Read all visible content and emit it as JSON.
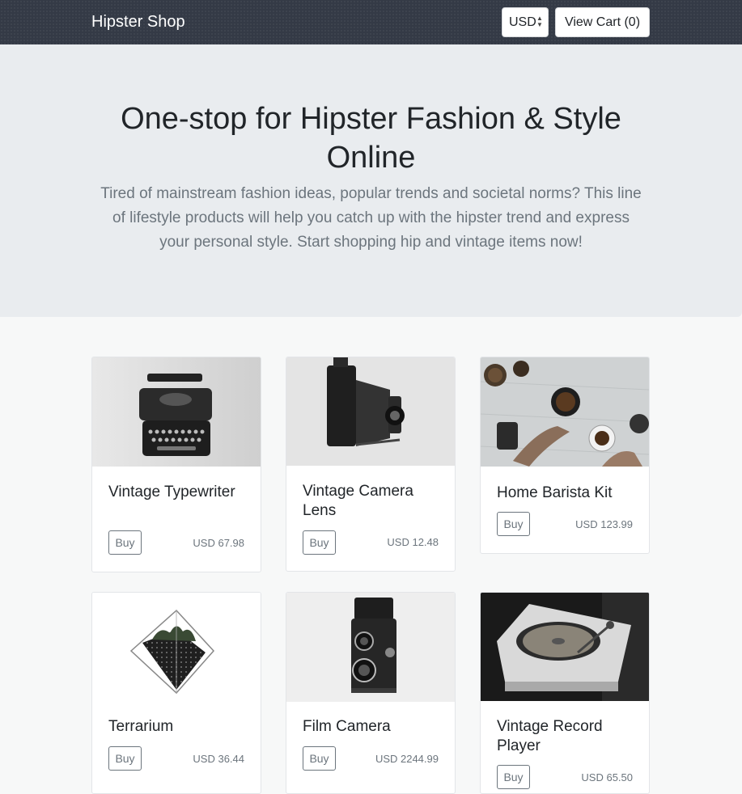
{
  "navbar": {
    "brand": "Hipster Shop",
    "currency": "USD",
    "cart_label": "View Cart (0)"
  },
  "hero": {
    "title": "One-stop for Hipster Fashion & Style Online",
    "subtitle": "Tired of mainstream fashion ideas, popular trends and societal norms? This line of lifestyle products will help you catch up with the hipster trend and express your personal style. Start shopping hip and vintage items now!"
  },
  "products": [
    {
      "name": "Vintage Typewriter",
      "buy_label": "Buy",
      "price": "USD 67.98",
      "icon": "typewriter-image"
    },
    {
      "name": "Vintage Camera Lens",
      "buy_label": "Buy",
      "price": "USD 12.48",
      "icon": "camera-lens-image"
    },
    {
      "name": "Home Barista Kit",
      "buy_label": "Buy",
      "price": "USD 123.99",
      "icon": "barista-kit-image"
    },
    {
      "name": "Terrarium",
      "buy_label": "Buy",
      "price": "USD 36.44",
      "icon": "terrarium-image"
    },
    {
      "name": "Film Camera",
      "buy_label": "Buy",
      "price": "USD 2244.99",
      "icon": "film-camera-image"
    },
    {
      "name": "Vintage Record Player",
      "buy_label": "Buy",
      "price": "USD 65.50",
      "icon": "record-player-image"
    }
  ]
}
